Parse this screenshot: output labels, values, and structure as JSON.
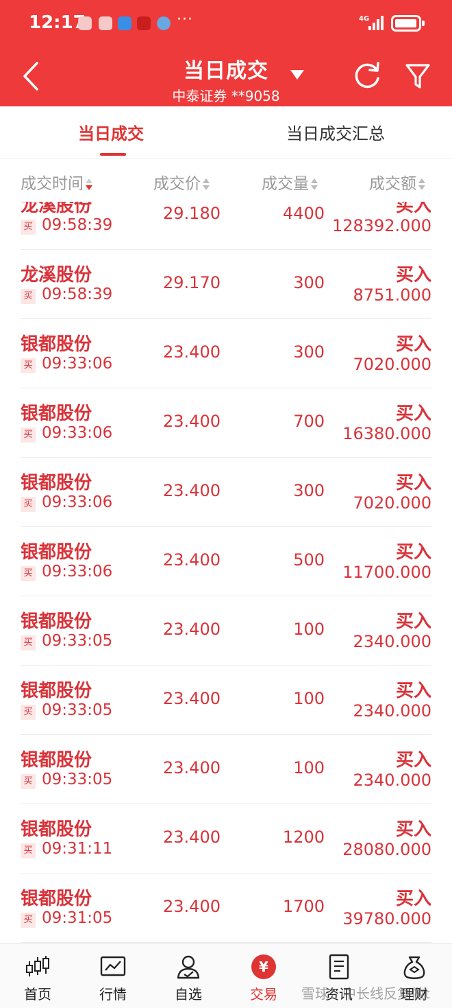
{
  "status_bar": {
    "time": "12:17",
    "network": "4G",
    "more": "···"
  },
  "header": {
    "title": "当日成交",
    "subtitle": "中泰证券 **9058"
  },
  "tabs": [
    {
      "label": "当日成交",
      "active": true
    },
    {
      "label": "当日成交汇总",
      "active": false
    }
  ],
  "columns": [
    "成交时间",
    "成交价",
    "成交量",
    "成交额"
  ],
  "rows": [
    {
      "name": "龙溪股份",
      "tag": "买",
      "time": "09:58:39",
      "price": "29.180",
      "qty": "4400",
      "side": "买入",
      "amount": "128392.000"
    },
    {
      "name": "龙溪股份",
      "tag": "买",
      "time": "09:58:39",
      "price": "29.170",
      "qty": "300",
      "side": "买入",
      "amount": "8751.000"
    },
    {
      "name": "银都股份",
      "tag": "买",
      "time": "09:33:06",
      "price": "23.400",
      "qty": "300",
      "side": "买入",
      "amount": "7020.000"
    },
    {
      "name": "银都股份",
      "tag": "买",
      "time": "09:33:06",
      "price": "23.400",
      "qty": "700",
      "side": "买入",
      "amount": "16380.000"
    },
    {
      "name": "银都股份",
      "tag": "买",
      "time": "09:33:06",
      "price": "23.400",
      "qty": "300",
      "side": "买入",
      "amount": "7020.000"
    },
    {
      "name": "银都股份",
      "tag": "买",
      "time": "09:33:06",
      "price": "23.400",
      "qty": "500",
      "side": "买入",
      "amount": "11700.000"
    },
    {
      "name": "银都股份",
      "tag": "买",
      "time": "09:33:05",
      "price": "23.400",
      "qty": "100",
      "side": "买入",
      "amount": "2340.000"
    },
    {
      "name": "银都股份",
      "tag": "买",
      "time": "09:33:05",
      "price": "23.400",
      "qty": "100",
      "side": "买入",
      "amount": "2340.000"
    },
    {
      "name": "银都股份",
      "tag": "买",
      "time": "09:33:05",
      "price": "23.400",
      "qty": "100",
      "side": "买入",
      "amount": "2340.000"
    },
    {
      "name": "银都股份",
      "tag": "买",
      "time": "09:31:11",
      "price": "23.400",
      "qty": "1200",
      "side": "买入",
      "amount": "28080.000"
    },
    {
      "name": "银都股份",
      "tag": "买",
      "time": "09:31:05",
      "price": "23.400",
      "qty": "1700",
      "side": "买入",
      "amount": "39780.000"
    }
  ],
  "bottom_nav": [
    {
      "label": "首页",
      "icon": "candlestick-icon",
      "active": false
    },
    {
      "label": "行情",
      "icon": "chart-icon",
      "active": false
    },
    {
      "label": "自选",
      "icon": "user-icon",
      "active": false
    },
    {
      "label": "交易",
      "icon": "yuan-icon",
      "active": true
    },
    {
      "label": "资讯",
      "icon": "document-icon",
      "active": false
    },
    {
      "label": "理财",
      "icon": "money-bag-icon",
      "active": false
    }
  ],
  "watermark": "雪球：中长线反复做t",
  "colors": {
    "brand_red": "#ee3a3a",
    "text_red": "#d9333a",
    "tag_bg": "#fde6e6"
  }
}
